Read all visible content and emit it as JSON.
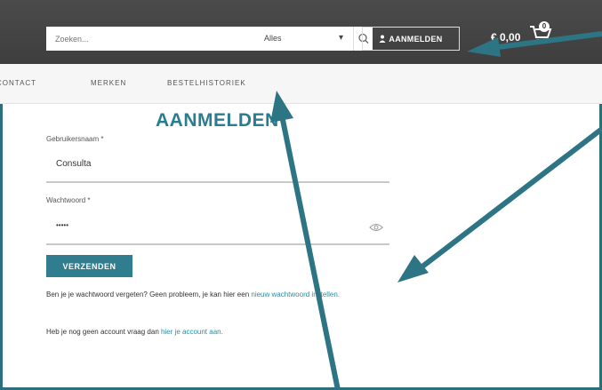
{
  "header": {
    "search": {
      "placeholder": "Zoeken...",
      "category": "Alles"
    },
    "login_label": "AANMELDEN",
    "cart_total": "€ 0,00",
    "cart_count": "0"
  },
  "nav": {
    "items": [
      "CONTACT",
      "MERKEN",
      "BESTELHISTORIEK"
    ]
  },
  "form": {
    "title": "AANMELDEN",
    "username_label": "Gebruikersnaam *",
    "username_value": "Consulta",
    "password_label": "Wachtwoord *",
    "password_value": "•••••",
    "submit_label": "VERZENDEN",
    "forgot_text": "Ben je je wachtwoord vergeten? Geen probleem, je kan hier een",
    "forgot_link": "nieuw wachtwoord instellen.",
    "no_account_text": "Heb je nog geen account vraag dan",
    "no_account_link": "hier je account aan."
  },
  "colors": {
    "accent": "#2a7d8e",
    "topbar": "#444444",
    "arrow": "#2d7484"
  }
}
